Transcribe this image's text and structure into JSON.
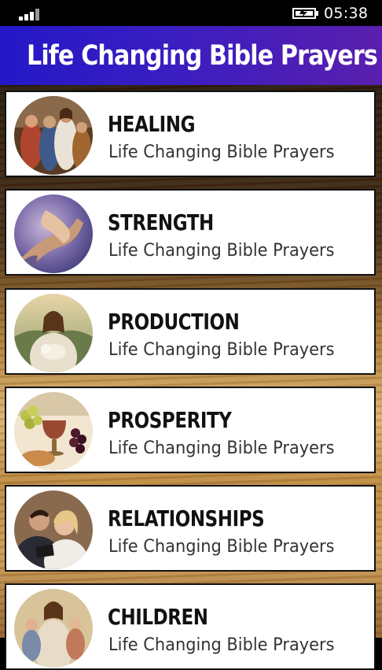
{
  "status_bar": {
    "time": "05:38",
    "signal_icon": "signal-strength-icon",
    "battery_icon": "battery-charging-icon"
  },
  "header": {
    "title": "Life Changing Bible Prayers",
    "gradient_colors": [
      "#2418c7",
      "#5a1fae"
    ]
  },
  "list": {
    "items": [
      {
        "title": "Healing",
        "subtitle": "Life Changing Bible Prayers",
        "image": "jesus-healing-crowd-image"
      },
      {
        "title": "Strength",
        "subtitle": "Life Changing Bible Prayers",
        "image": "clasped-hands-image"
      },
      {
        "title": "Production",
        "subtitle": "Life Changing Bible Prayers",
        "image": "jesus-holding-lamb-image"
      },
      {
        "title": "Prosperity",
        "subtitle": "Life Changing Bible Prayers",
        "image": "wine-grapes-bread-image"
      },
      {
        "title": "Relationships",
        "subtitle": "Life Changing Bible Prayers",
        "image": "couple-reading-bible-image"
      },
      {
        "title": "Children",
        "subtitle": "Life Changing Bible Prayers",
        "image": "jesus-with-children-image"
      }
    ]
  }
}
